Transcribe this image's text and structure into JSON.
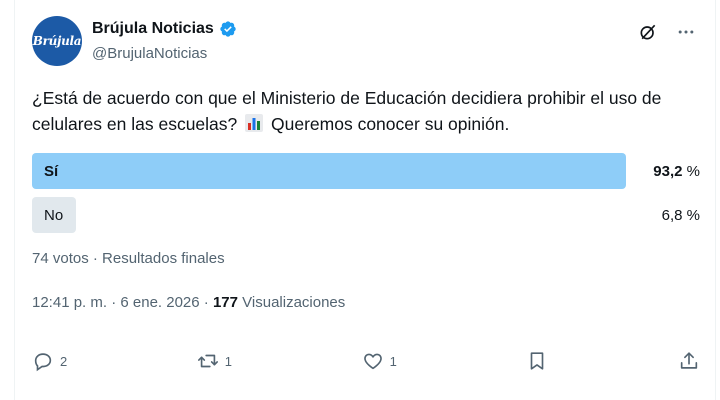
{
  "account": {
    "display_name": "Brújula Noticias",
    "handle": "@BrujulaNoticias",
    "avatar_text": "Brújula",
    "verified_icon": "verified-badge-icon"
  },
  "tweet": {
    "text_part1": "¿Está de acuerdo con que el Ministerio de Educación decidiera prohibir el uso de celulares en las escuelas?",
    "emoji_icon": "bar-chart-emoji-icon",
    "text_part2": "Queremos conocer su opinión."
  },
  "poll": {
    "options": [
      {
        "label": "Sí",
        "percent_text": "93,2",
        "unit": "%",
        "fraction": 0.932,
        "winner": true
      },
      {
        "label": "No",
        "percent_text": "6,8",
        "unit": "%",
        "fraction": 0.068,
        "winner": false
      }
    ],
    "meta": "74 votos · Resultados finales"
  },
  "timestamp": {
    "time_date": "12:41 p. m. · 6 ene. 2026 · ",
    "views_count": "177",
    "views_label": "Visualizaciones"
  },
  "actions": {
    "reply_count": "2",
    "repost_count": "1",
    "like_count": "1"
  },
  "colors": {
    "winner_bar": "#8ecdf8",
    "loser_bar": "#e1e8ed",
    "verified": "#1d9bf0",
    "secondary_text": "#536471"
  }
}
